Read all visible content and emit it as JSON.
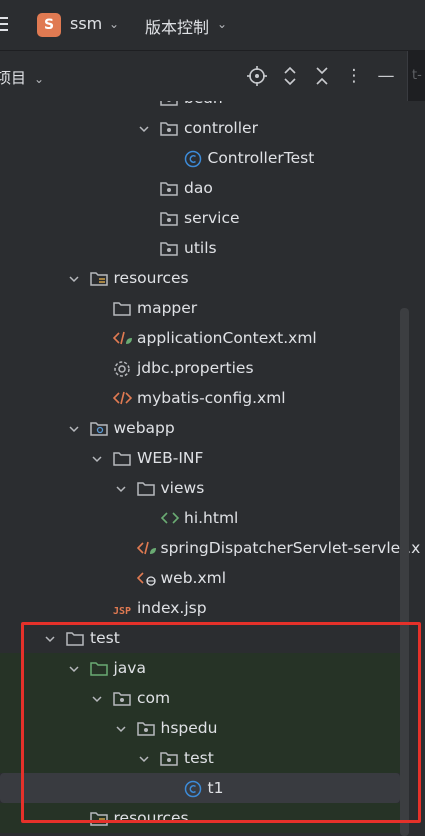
{
  "topbar": {
    "project_badge": "S",
    "project_name": "ssm",
    "vcs_label": "版本控制"
  },
  "toolbar": {
    "title": "项目",
    "tab_fragment": "t-"
  },
  "tree": [
    {
      "name": "bean",
      "type": "package",
      "expanded": null,
      "indent": 4,
      "partial": true
    },
    {
      "name": "controller",
      "type": "package",
      "expanded": true,
      "indent": 4
    },
    {
      "name": "ControllerTest",
      "type": "java-class",
      "expanded": null,
      "indent": 5
    },
    {
      "name": "dao",
      "type": "package",
      "expanded": null,
      "indent": 4
    },
    {
      "name": "service",
      "type": "package",
      "expanded": null,
      "indent": 4
    },
    {
      "name": "utils",
      "type": "package",
      "expanded": null,
      "indent": 4
    },
    {
      "name": "resources",
      "type": "resources-folder",
      "expanded": true,
      "indent": 1
    },
    {
      "name": "mapper",
      "type": "folder",
      "expanded": null,
      "indent": 2
    },
    {
      "name": "applicationContext.xml",
      "type": "spring-xml",
      "expanded": null,
      "indent": 2
    },
    {
      "name": "jdbc.properties",
      "type": "properties",
      "expanded": null,
      "indent": 2
    },
    {
      "name": "mybatis-config.xml",
      "type": "xml",
      "expanded": null,
      "indent": 2
    },
    {
      "name": "webapp",
      "type": "web-folder",
      "expanded": true,
      "indent": 1
    },
    {
      "name": "WEB-INF",
      "type": "folder",
      "expanded": true,
      "indent": 2
    },
    {
      "name": "views",
      "type": "folder",
      "expanded": true,
      "indent": 3
    },
    {
      "name": "hi.html",
      "type": "html",
      "expanded": null,
      "indent": 4
    },
    {
      "name": "springDispatcherServlet-servlet.x",
      "type": "spring-xml",
      "expanded": null,
      "indent": 3
    },
    {
      "name": "web.xml",
      "type": "web-xml",
      "expanded": null,
      "indent": 3
    },
    {
      "name": "index.jsp",
      "type": "jsp",
      "expanded": null,
      "indent": 2
    },
    {
      "name": "test",
      "type": "folder",
      "expanded": true,
      "indent": 0
    },
    {
      "name": "java",
      "type": "test-folder",
      "expanded": true,
      "indent": 1,
      "green": true
    },
    {
      "name": "com",
      "type": "package",
      "expanded": true,
      "indent": 2,
      "green": true
    },
    {
      "name": "hspedu",
      "type": "package",
      "expanded": true,
      "indent": 3,
      "green": true
    },
    {
      "name": "test",
      "type": "package",
      "expanded": true,
      "indent": 4,
      "green": true
    },
    {
      "name": "t1",
      "type": "java-class",
      "expanded": null,
      "indent": 5,
      "green": true,
      "selected": true
    },
    {
      "name": "resources",
      "type": "test-resources-folder",
      "expanded": null,
      "indent": 1,
      "green": true,
      "partial": true
    }
  ],
  "colors": {
    "accent_highlight": "#e5312a",
    "project_badge": "#e07a52",
    "class_icon": "#3d8bd8",
    "test_green": "#6aab73"
  }
}
